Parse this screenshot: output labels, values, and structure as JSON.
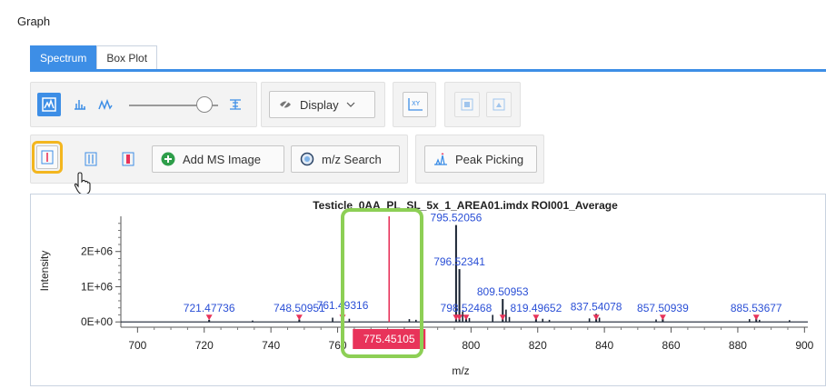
{
  "panel": {
    "title": "Graph"
  },
  "tabs": [
    {
      "label": "Spectrum",
      "active": true
    },
    {
      "label": "Box Plot",
      "active": false
    }
  ],
  "toolbar1": {
    "display_label": "Display",
    "slider_value": 0.85,
    "icons": [
      "spectrum-mode-icon",
      "stick-mode-icon",
      "profile-mode-icon",
      "zoom-icon",
      "display-icon",
      "xy-axis-icon",
      "export-image-icon",
      "copy-image-icon"
    ]
  },
  "toolbar2": {
    "add_ms_image_label": "Add MS Image",
    "mz_search_label": "m/z Search",
    "peak_picking_label": "Peak Picking"
  },
  "chart_data": {
    "type": "line",
    "title": "Testicle_0AA_PL_SL_5x_1_AREA01.imdx ROI001_Average",
    "xlabel": "m/z",
    "ylabel": "Intensity",
    "xlim": [
      695,
      901
    ],
    "ylim": [
      -150000,
      3000000
    ],
    "x_ticks": [
      "700",
      "720",
      "740",
      "760",
      "780",
      "800",
      "820",
      "840",
      "860",
      "880",
      "900"
    ],
    "y_ticks": [
      {
        "label": "0E+00",
        "value": 0
      },
      {
        "label": "1E+06",
        "value": 1000000
      },
      {
        "label": "2E+06",
        "value": 2000000
      }
    ],
    "peaks": [
      {
        "x": 721.47736,
        "y": 60000,
        "label": "721.47736"
      },
      {
        "x": 748.50951,
        "y": 70000,
        "label": "748.50951"
      },
      {
        "x": 761.49316,
        "y": 260000,
        "label": "761.49316"
      },
      {
        "x": 795.52056,
        "y": 2750000,
        "label": "795.52056"
      },
      {
        "x": 796.52341,
        "y": 1500000,
        "label": "796.52341"
      },
      {
        "x": 798.52468,
        "y": 150000,
        "label": "798.52468"
      },
      {
        "x": 809.50953,
        "y": 650000,
        "label": "809.50953"
      },
      {
        "x": 819.49652,
        "y": 100000,
        "label": "819.49652"
      },
      {
        "x": 837.54078,
        "y": 230000,
        "label": "837.54078"
      },
      {
        "x": 857.50939,
        "y": 90000,
        "label": "857.50939"
      },
      {
        "x": 885.53677,
        "y": 110000,
        "label": "885.53677"
      }
    ],
    "minor_peaks": [
      {
        "x": 734.5,
        "y": 40000
      },
      {
        "x": 758.5,
        "y": 120000
      },
      {
        "x": 763.5,
        "y": 90000
      },
      {
        "x": 781.5,
        "y": 80000
      },
      {
        "x": 783.5,
        "y": 60000
      },
      {
        "x": 797.5,
        "y": 300000
      },
      {
        "x": 799.5,
        "y": 110000
      },
      {
        "x": 806.5,
        "y": 200000
      },
      {
        "x": 810.5,
        "y": 350000
      },
      {
        "x": 811.5,
        "y": 140000
      },
      {
        "x": 821.5,
        "y": 90000
      },
      {
        "x": 823.5,
        "y": 60000
      },
      {
        "x": 835.5,
        "y": 100000
      },
      {
        "x": 838.5,
        "y": 120000
      },
      {
        "x": 855.5,
        "y": 70000
      },
      {
        "x": 883.5,
        "y": 80000
      },
      {
        "x": 886.5,
        "y": 60000
      },
      {
        "x": 895.5,
        "y": 50000
      }
    ],
    "marker": {
      "x": 775.45105,
      "label": "775.45105",
      "color": "#e8335a"
    },
    "series_color": "#1a2333",
    "label_color": "#2a4fd6",
    "peak_marker_color": "#e8335a"
  }
}
